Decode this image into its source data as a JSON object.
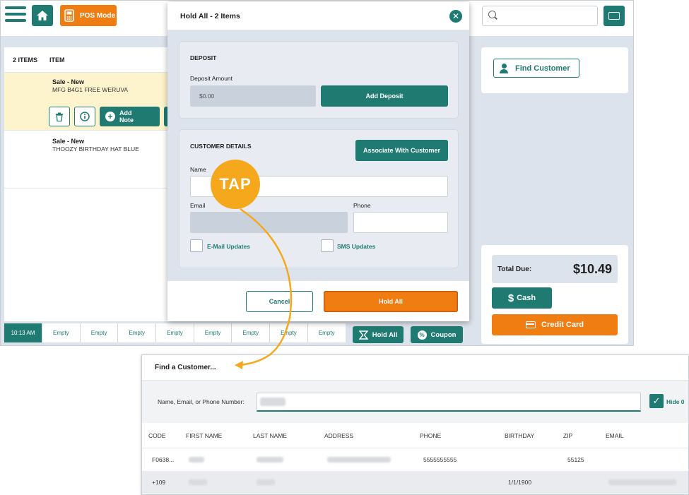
{
  "pos": {
    "pos_mode_label": "POS Mode",
    "item_list": {
      "count_header": "2 ITEMS",
      "item_header": "ITEM",
      "items": [
        {
          "title": "Sale - New",
          "name": "MFG B4G1 FREE WERUVA"
        },
        {
          "title": "Sale - New",
          "name": "THOOZY BIRTHDAY HAT BLUE"
        }
      ],
      "add_note_label_1": "Add",
      "add_note_label_2": "Note"
    },
    "timebar": {
      "time": "10:13 AM",
      "slots": [
        "Empty",
        "Empty",
        "Empty",
        "Empty",
        "Empty",
        "Empty",
        "Empty",
        "Empty"
      ]
    },
    "hold_all_label": "Hold All",
    "coupon_label": "Coupon",
    "find_customer_label": "Find Customer",
    "total_due_label": "Total Due:",
    "total_due_amount": "$10.49",
    "cash_label": "Cash",
    "credit_card_label": "Credit Card"
  },
  "modal": {
    "title": "Hold All - 2 Items",
    "deposit": {
      "section_title": "DEPOSIT",
      "amount_label": "Deposit Amount",
      "amount_value": "$0.00",
      "add_button": "Add Deposit"
    },
    "customer": {
      "section_title": "CUSTOMER DETAILS",
      "associate_button": "Associate With Customer",
      "name_label": "Name",
      "email_label": "Email",
      "phone_label": "Phone",
      "email_updates_label": "E-Mail Updates",
      "sms_updates_label": "SMS Updates"
    },
    "cancel_label": "Cancel",
    "hold_all_label": "Hold All"
  },
  "callout": {
    "tap_label": "TAP",
    "color": "#f5a81c"
  },
  "find_customer": {
    "title": "Find a Customer...",
    "search_label": "Name, Email, or Phone Number:",
    "hide_label": "Hide 0",
    "columns": [
      "CODE",
      "FIRST NAME",
      "LAST NAME",
      "ADDRESS",
      "PHONE",
      "BIRTHDAY",
      "ZIP",
      "EMAIL"
    ],
    "rows": [
      {
        "code": "F0638...",
        "phone": "5555555555",
        "birthday": "",
        "zip": "55125"
      },
      {
        "code": "+109",
        "phone": "",
        "birthday": "1/1/1900",
        "zip": ""
      }
    ]
  },
  "colors": {
    "teal": "#1f7a72",
    "orange": "#f07d12",
    "highlight": "#fdf3cc"
  }
}
